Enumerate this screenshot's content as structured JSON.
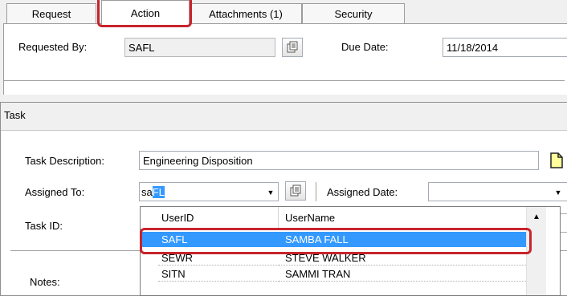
{
  "tabs": [
    {
      "label": "Request"
    },
    {
      "label": "Action"
    },
    {
      "label": "Attachments (1)"
    },
    {
      "label": "Security"
    }
  ],
  "request": {
    "requested_by_label": "Requested By:",
    "requested_by_value": "SAFL",
    "due_date_label": "Due Date:",
    "due_date_value": "11/18/2014"
  },
  "task": {
    "group_title": "Task",
    "description_label": "Task Description:",
    "description_value": "Engineering Disposition",
    "assigned_to_label": "Assigned To:",
    "assigned_to_typed": "sa",
    "assigned_to_selected": "FL",
    "assigned_date_label": "Assigned Date:",
    "task_id_label": "Task ID:",
    "notes_label": "Notes:"
  },
  "dropdown": {
    "columns": [
      "UserID",
      "UserName"
    ],
    "rows": [
      {
        "id": "SAFL",
        "name": "SAMBA FALL",
        "selected": true
      },
      {
        "id": "SEWR",
        "name": "STEVE WALKER",
        "selected": false
      },
      {
        "id": "SITN",
        "name": "SAMMI TRAN",
        "selected": false
      }
    ]
  },
  "colors": {
    "highlight": "#c8242d",
    "selection": "#3399ff"
  }
}
